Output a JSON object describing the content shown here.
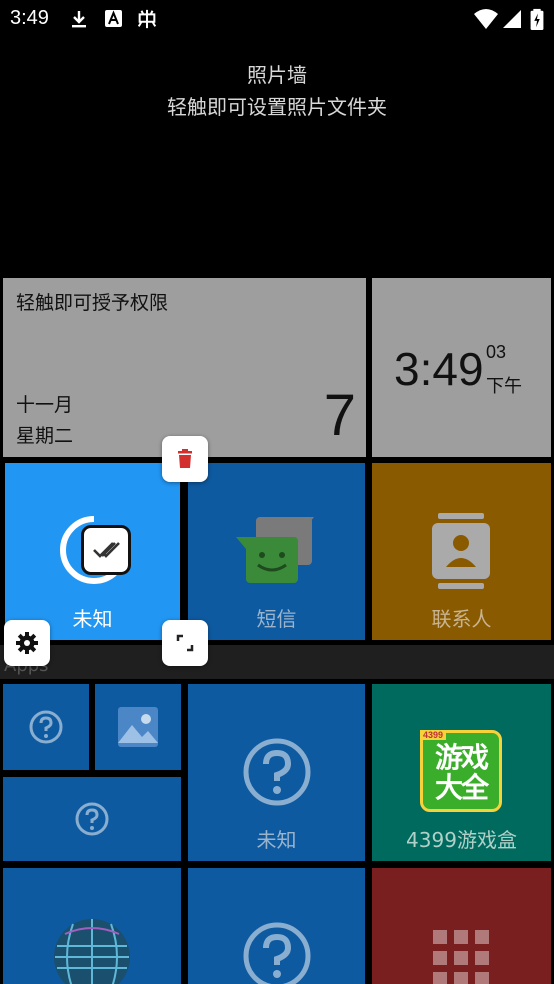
{
  "status_bar": {
    "time": "3:49",
    "icons": [
      "download-icon",
      "font-app-icon",
      "bug-icon",
      "wifi-icon",
      "cellular-signal-icon",
      "battery-charging-icon"
    ]
  },
  "header": {
    "title": "照片墙",
    "subtitle": "轻触即可设置照片文件夹"
  },
  "calendar_tile": {
    "permission_text": "轻触即可授予权限",
    "month": "十一月",
    "weekday": "星期二",
    "day": "7"
  },
  "clock_tile": {
    "time": "3:49",
    "seconds": "03",
    "ampm": "下午"
  },
  "tiles": {
    "selected": {
      "label": "未知",
      "color": "#2196f3"
    },
    "sms": {
      "label": "短信",
      "color": "#0e5aa0"
    },
    "contacts": {
      "label": "联系人",
      "color": "#8a5a00"
    },
    "unknown_large": {
      "label": "未知",
      "color": "#0e5aa0"
    },
    "game_box": {
      "label": "4399游戏盒",
      "color": "#006a5f",
      "logo_text": "游戏大全",
      "logo_badge": "4399"
    },
    "red_app": {
      "color": "#7a1f1f"
    }
  },
  "apps_section": {
    "label": "Apps"
  },
  "edit_controls": {
    "delete": "delete-icon",
    "resize": "resize-icon",
    "settings": "gear-icon"
  }
}
